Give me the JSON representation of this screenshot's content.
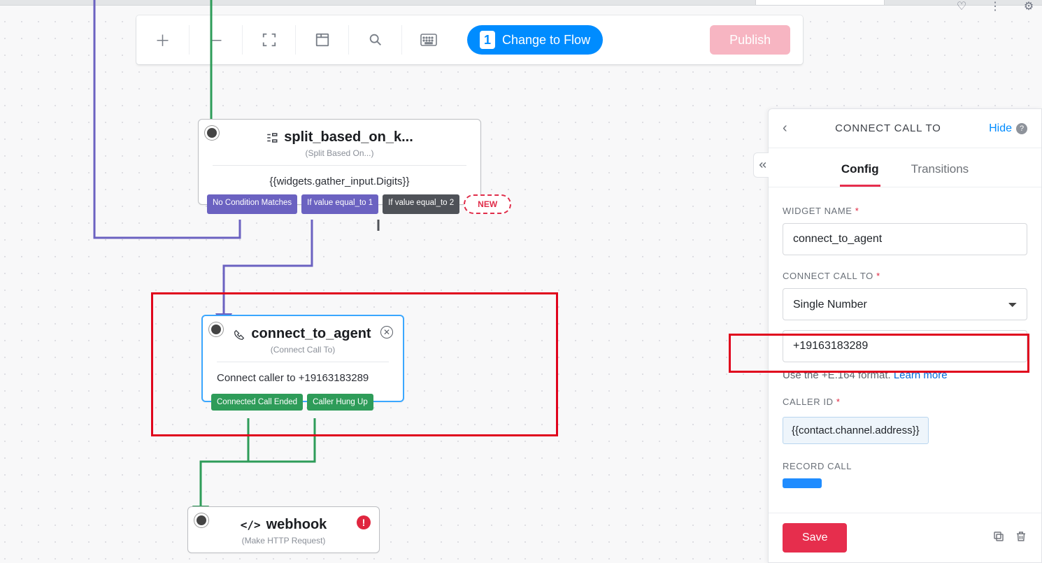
{
  "toolbar": {
    "flow_badge": "1",
    "flow_label": "Change to Flow",
    "publish_label": "Publish"
  },
  "widgets": {
    "split": {
      "title": "split_based_on_k...",
      "subtitle": "(Split Based On...)",
      "body": "{{widgets.gather_input.Digits}}",
      "tags": [
        "No Condition Matches",
        "If value equal_to 1",
        "If value equal_to 2"
      ],
      "new_label": "NEW"
    },
    "connect": {
      "title": "connect_to_agent",
      "subtitle": "(Connect Call To)",
      "body": "Connect caller to +19163183289",
      "tags": [
        "Connected Call Ended",
        "Caller Hung Up"
      ]
    },
    "webhook": {
      "title": "webhook",
      "subtitle": "(Make HTTP Request)"
    }
  },
  "panel": {
    "title": "CONNECT CALL TO",
    "hide": "Hide",
    "tabs": {
      "config": "Config",
      "transitions": "Transitions"
    },
    "labels": {
      "widget_name": "WIDGET NAME",
      "connect_to": "CONNECT CALL TO",
      "caller_id": "CALLER ID",
      "record": "RECORD CALL"
    },
    "values": {
      "widget_name": "connect_to_agent",
      "connect_select": "Single Number",
      "number": "+19163183289",
      "caller_id": "{{contact.channel.address}}"
    },
    "hint_text": "Use the +E.164 format.",
    "hint_link": "Learn more",
    "save": "Save"
  },
  "colors": {
    "primary_blue": "#008cff",
    "danger_red": "#e62e4d",
    "green": "#2e9c59",
    "purple": "#6b62c1"
  }
}
